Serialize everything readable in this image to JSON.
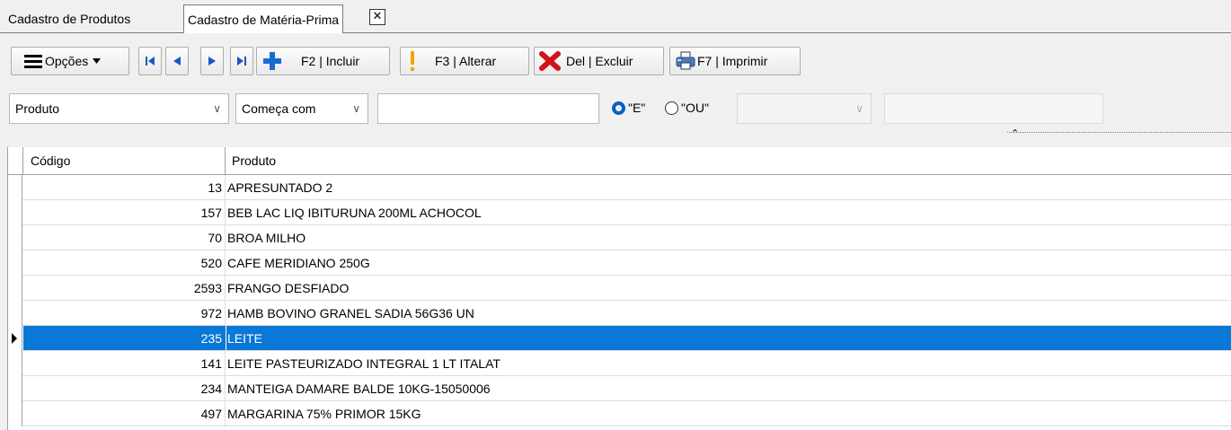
{
  "tabs": {
    "tab1": "Cadastro de Produtos",
    "tab2": "Cadastro de Matéria-Prima",
    "close_glyph": "✕"
  },
  "toolbar": {
    "options": "Opções",
    "include": "F2 | Incluir",
    "edit": "F3 | Alterar",
    "delete": "Del | Excluir",
    "print": "F7 | Imprimir"
  },
  "filter": {
    "field": "Produto",
    "operator": "Começa com",
    "value": "",
    "radio_and": "\"E\"",
    "radio_or": "\"OU\"",
    "radio_selected": "and"
  },
  "grid": {
    "columns": [
      "Código",
      "Produto"
    ],
    "selected_index": 6,
    "rows": [
      {
        "code": "13",
        "name": "APRESUNTADO 2"
      },
      {
        "code": "157",
        "name": "BEB LAC LIQ IBITURUNA 200ML ACHOCOL"
      },
      {
        "code": "70",
        "name": "BROA MILHO"
      },
      {
        "code": "520",
        "name": "CAFE MERIDIANO 250G"
      },
      {
        "code": "2593",
        "name": "FRANGO DESFIADO"
      },
      {
        "code": "972",
        "name": "HAMB BOVINO GRANEL SADIA 56G36 UN"
      },
      {
        "code": "235",
        "name": "LEITE"
      },
      {
        "code": "141",
        "name": "LEITE PASTEURIZADO INTEGRAL 1 LT ITALAT"
      },
      {
        "code": "234",
        "name": "MANTEIGA DAMARE BALDE 10KG-15050006"
      },
      {
        "code": "497",
        "name": "MARGARINA 75% PRIMOR 15KG"
      }
    ]
  },
  "colors": {
    "selection": "#0a78d7",
    "accent_blue": "#0b5fc6",
    "add_icon": "#1a6bd1",
    "delete_icon": "#d0141b",
    "edit_icon": "#f0a500"
  },
  "icons": {
    "menu": "hamburger-icon",
    "first": "first-record-icon",
    "prev": "prev-record-icon",
    "next": "next-record-icon",
    "last": "last-record-icon",
    "add": "plus-icon",
    "edit": "exclamation-icon",
    "delete": "x-icon",
    "print": "printer-icon"
  }
}
